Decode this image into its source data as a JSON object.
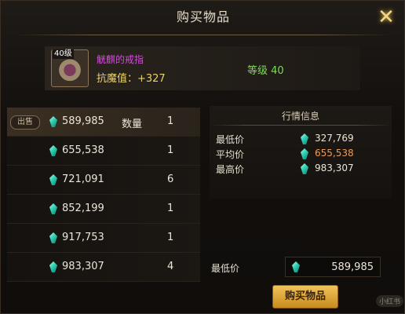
{
  "window": {
    "title": "购买物品"
  },
  "item": {
    "level_badge": "40级",
    "name": "觥麒的戒指",
    "stat": "抗魔值：+327",
    "grade": "等级 40"
  },
  "listings": [
    {
      "tag": "出售",
      "price": "589,985",
      "qty_label": "数量",
      "qty": "1"
    },
    {
      "tag": "",
      "price": "655,538",
      "qty_label": "",
      "qty": "1"
    },
    {
      "tag": "",
      "price": "721,091",
      "qty_label": "",
      "qty": "6"
    },
    {
      "tag": "",
      "price": "852,199",
      "qty_label": "",
      "qty": "1"
    },
    {
      "tag": "",
      "price": "917,753",
      "qty_label": "",
      "qty": "1"
    },
    {
      "tag": "",
      "price": "983,307",
      "qty_label": "",
      "qty": "4"
    }
  ],
  "market": {
    "title": "行情信息",
    "rows": [
      {
        "label": "最低价",
        "value": "327,769"
      },
      {
        "label": "平均价",
        "value": "655,538"
      },
      {
        "label": "最高价",
        "value": "983,307"
      }
    ]
  },
  "purchase": {
    "price_label": "最低价",
    "price_value": "589,985",
    "buy_label": "购买物品"
  },
  "watermark": "小红书",
  "colors": {
    "accent_gold": "#e0a93a",
    "item_name": "#d64ae0",
    "grade_green": "#7ed957",
    "avg_orange": "#ef9b54",
    "gem_cyan": "#2fd0b3"
  },
  "icons": {
    "currency": "gem-icon",
    "close": "close-icon"
  }
}
